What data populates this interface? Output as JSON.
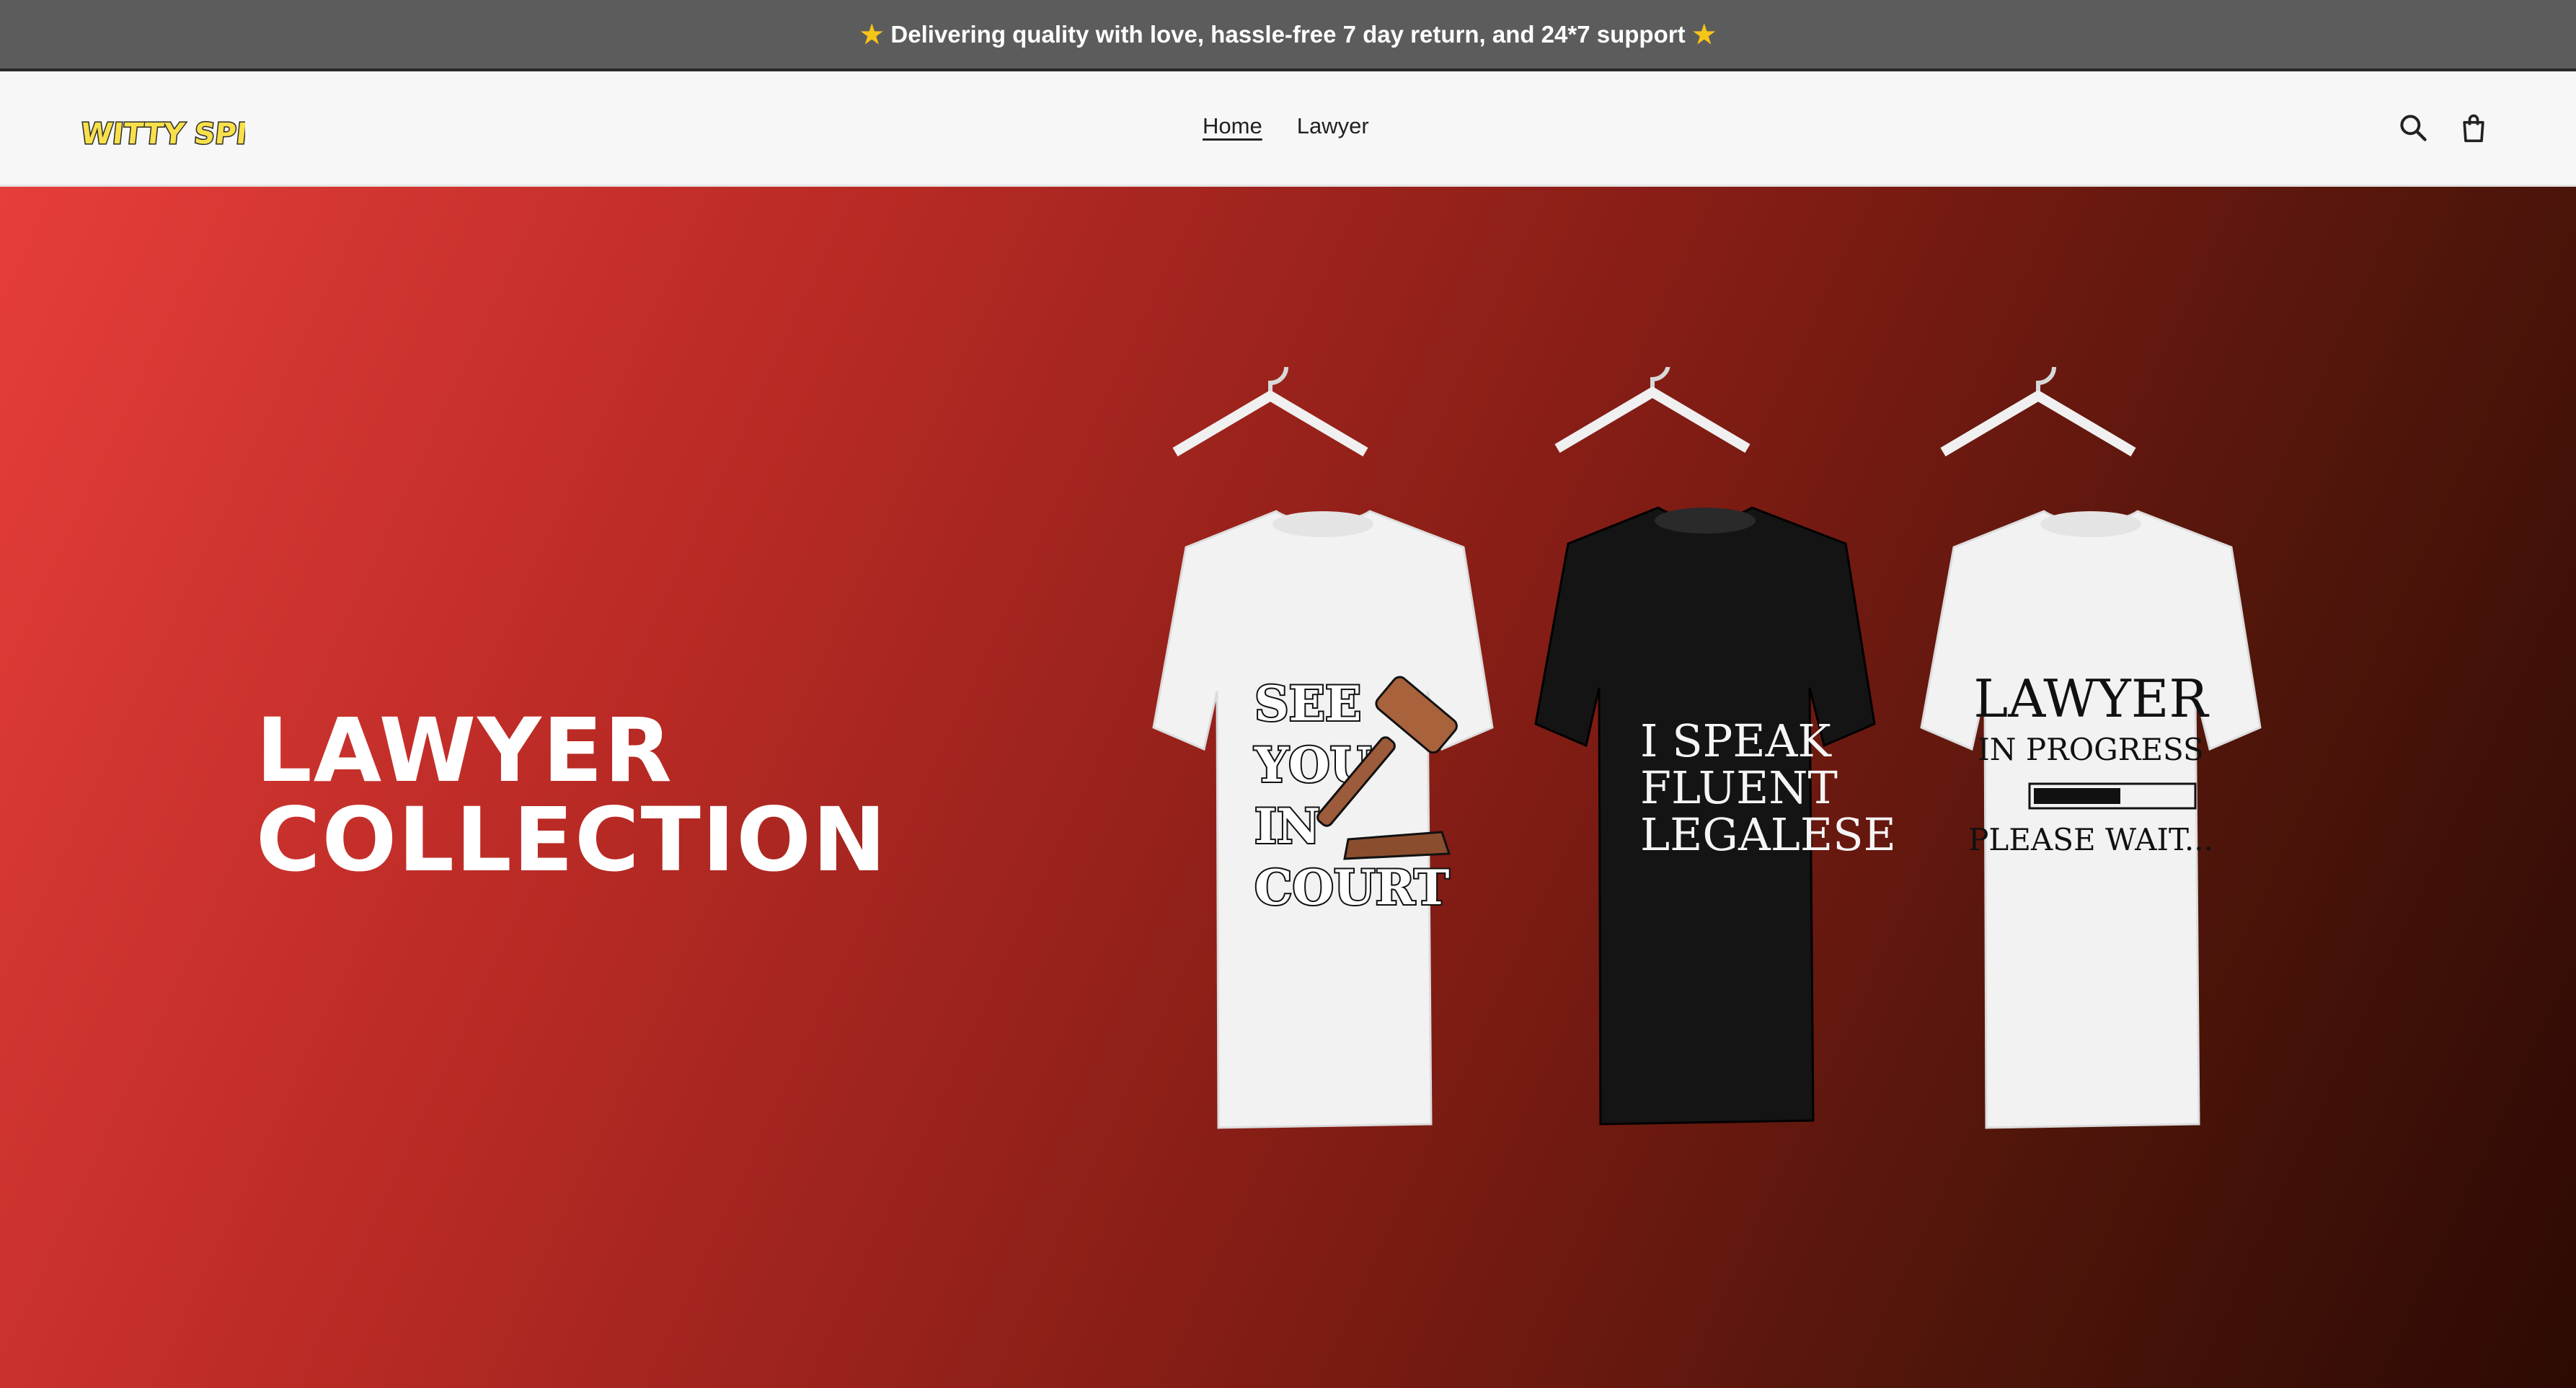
{
  "announcement": {
    "text": "Delivering quality with love, hassle-free 7 day return, and 24*7 support",
    "icon": "star-icon"
  },
  "header": {
    "logo_text": "WITTY SPIRIT",
    "nav": [
      {
        "label": "Home",
        "active": true
      },
      {
        "label": "Lawyer",
        "active": false
      }
    ],
    "icons": [
      "search-icon",
      "cart-icon"
    ]
  },
  "hero": {
    "title_line1": "LAWYER",
    "title_line2": "COLLECTION",
    "shirts": [
      {
        "color": "white",
        "lines": [
          "SEE",
          "YOU",
          "IN",
          "COURT"
        ],
        "icon": "gavel-icon"
      },
      {
        "color": "black",
        "lines": [
          "I SPEAK",
          "FLUENT",
          "LEGALESE"
        ]
      },
      {
        "color": "white",
        "lines": [
          "LAWYER",
          "IN PROGRESS",
          "PLEASE WAIT..."
        ],
        "icon": "progress-bar-icon"
      }
    ]
  },
  "colors": {
    "announcement_bg": "#5c5c5c",
    "header_bg": "#f7f7f7",
    "hero_gradient_start": "#e63e3a",
    "hero_gradient_end": "#2c0a04",
    "logo_yellow": "#f7e04a"
  }
}
